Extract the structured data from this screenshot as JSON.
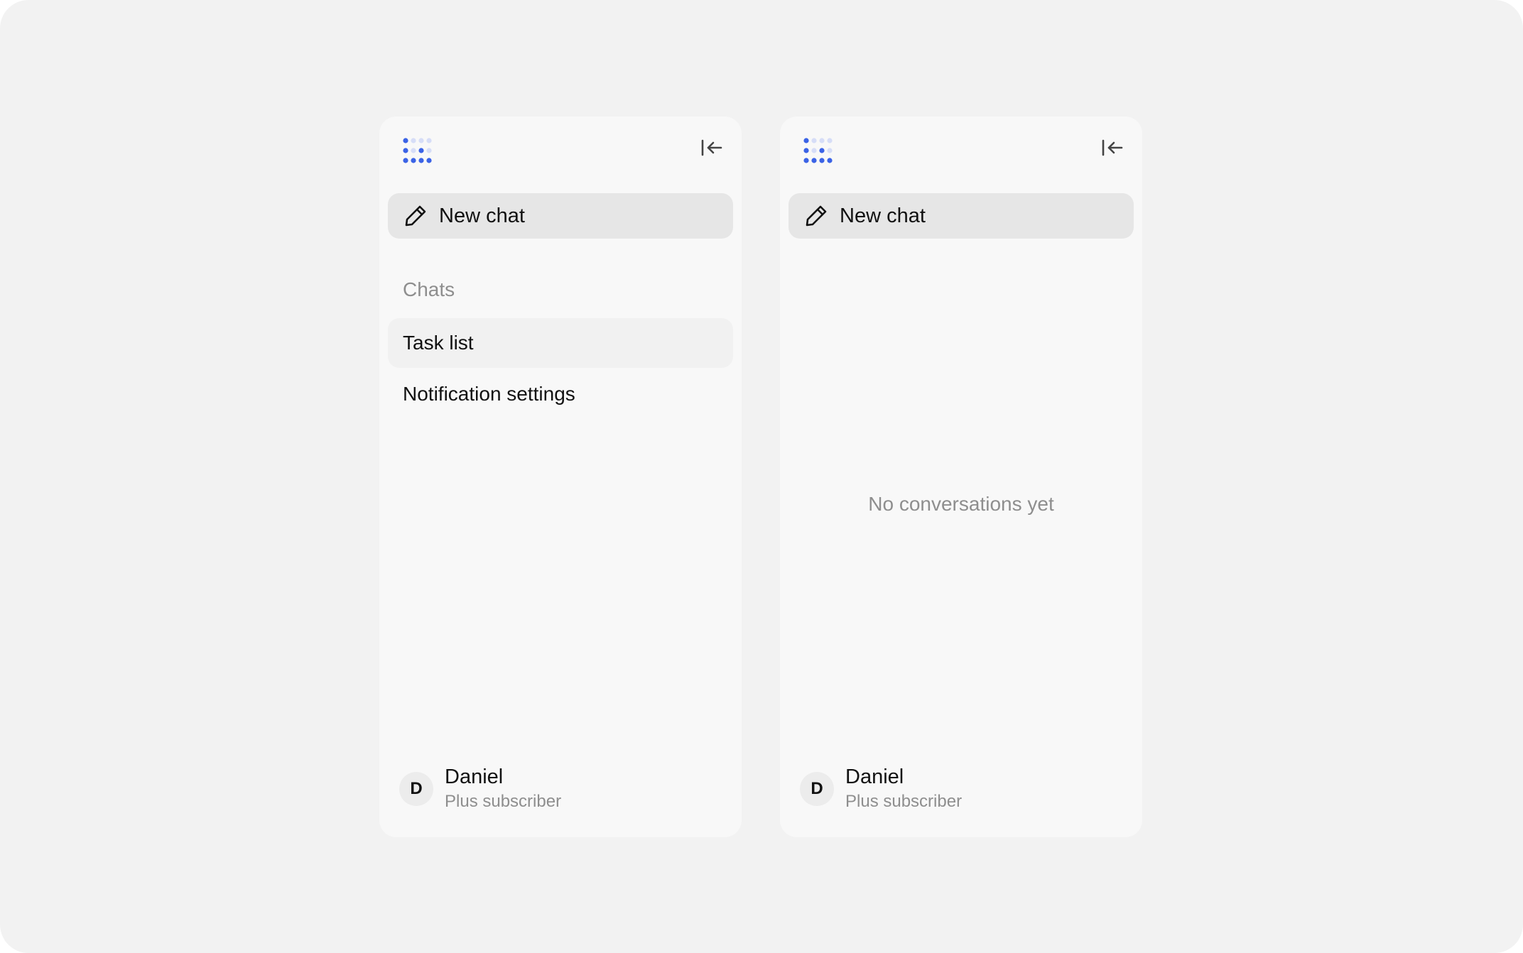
{
  "colors": {
    "page_bg": "#f2f2f2",
    "panel_bg": "#f8f8f8",
    "new_chat_bg": "#e6e6e6",
    "active_item_bg": "#f1f1f1",
    "logo_blue": "#3b63e6",
    "logo_light": "#d6ddf7",
    "muted_text": "#8e8e8e"
  },
  "icons": {
    "logo": "dot-grid-logo-icon",
    "collapse": "collapse-sidebar-icon",
    "new_chat": "pencil-icon"
  },
  "left_panel": {
    "new_chat_label": "New chat",
    "section_title": "Chats",
    "chats": [
      {
        "label": "Task list",
        "active": true
      },
      {
        "label": "Notification settings",
        "active": false
      }
    ],
    "user": {
      "initial": "D",
      "name": "Daniel",
      "plan": "Plus subscriber"
    }
  },
  "right_panel": {
    "new_chat_label": "New chat",
    "empty_text": "No conversations yet",
    "user": {
      "initial": "D",
      "name": "Daniel",
      "plan": "Plus subscriber"
    }
  }
}
